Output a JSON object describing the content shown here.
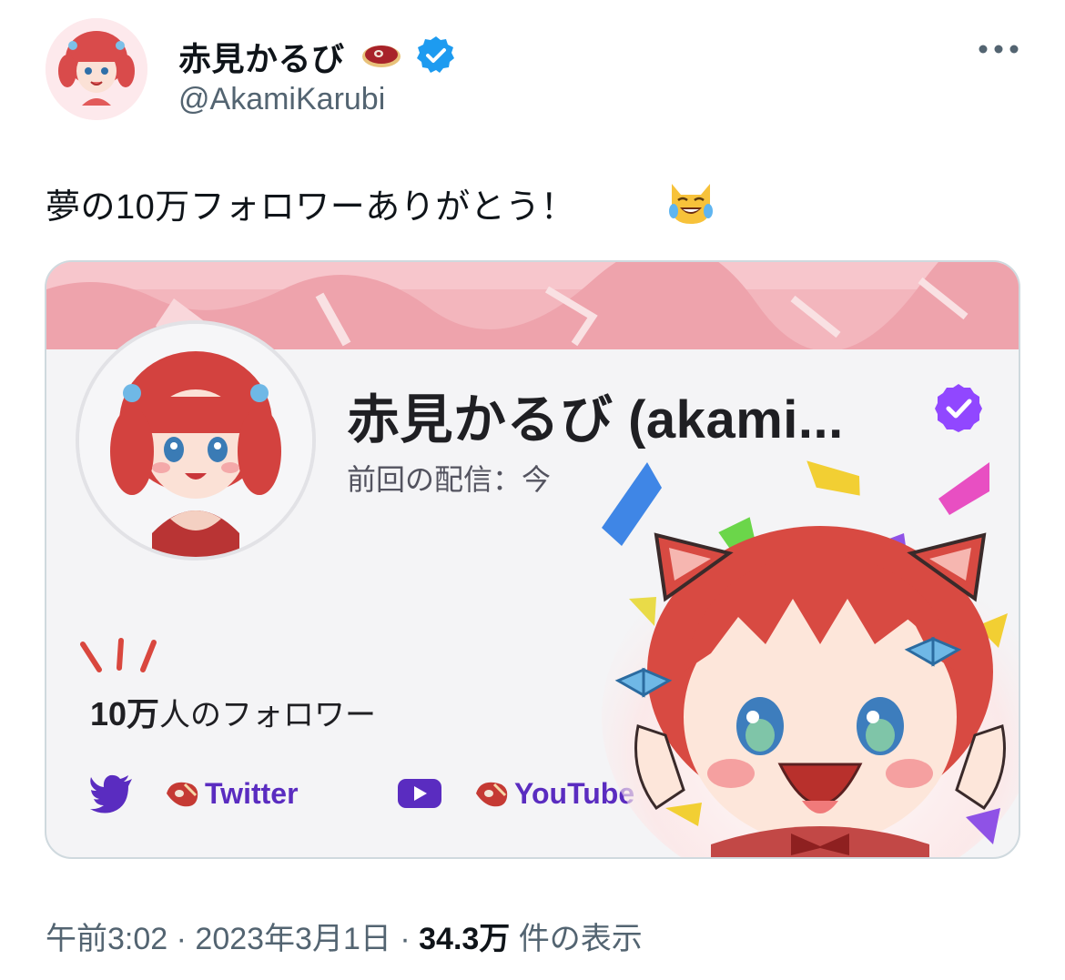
{
  "tweet": {
    "author": {
      "display_name": "赤見かるび",
      "handle": "@AkamiKarubi"
    },
    "text": "夢の10万フォロワーありがとう！",
    "emoji": "crying-laughing-cat-emoji"
  },
  "card": {
    "name": "赤見かるび (akami...",
    "status": "前回の配信：今",
    "followers_count": "10万",
    "followers_suffix": "人のフォロワー",
    "links": [
      {
        "icon": "twitter-bird-icon",
        "label": "Twitter"
      },
      {
        "icon": "youtube-icon",
        "label": "YouTube"
      }
    ]
  },
  "footer": {
    "time": "午前3:02",
    "sep1": "·",
    "date": "2023年3月1日",
    "sep2": "·",
    "views_count": "34.3万",
    "views_label": "件の表示"
  },
  "colors": {
    "verified_blue": "#1d9bf0",
    "twitch_purple": "#5a2cc0",
    "banner_pink": "#f3b6bd",
    "text_secondary": "#536471"
  }
}
